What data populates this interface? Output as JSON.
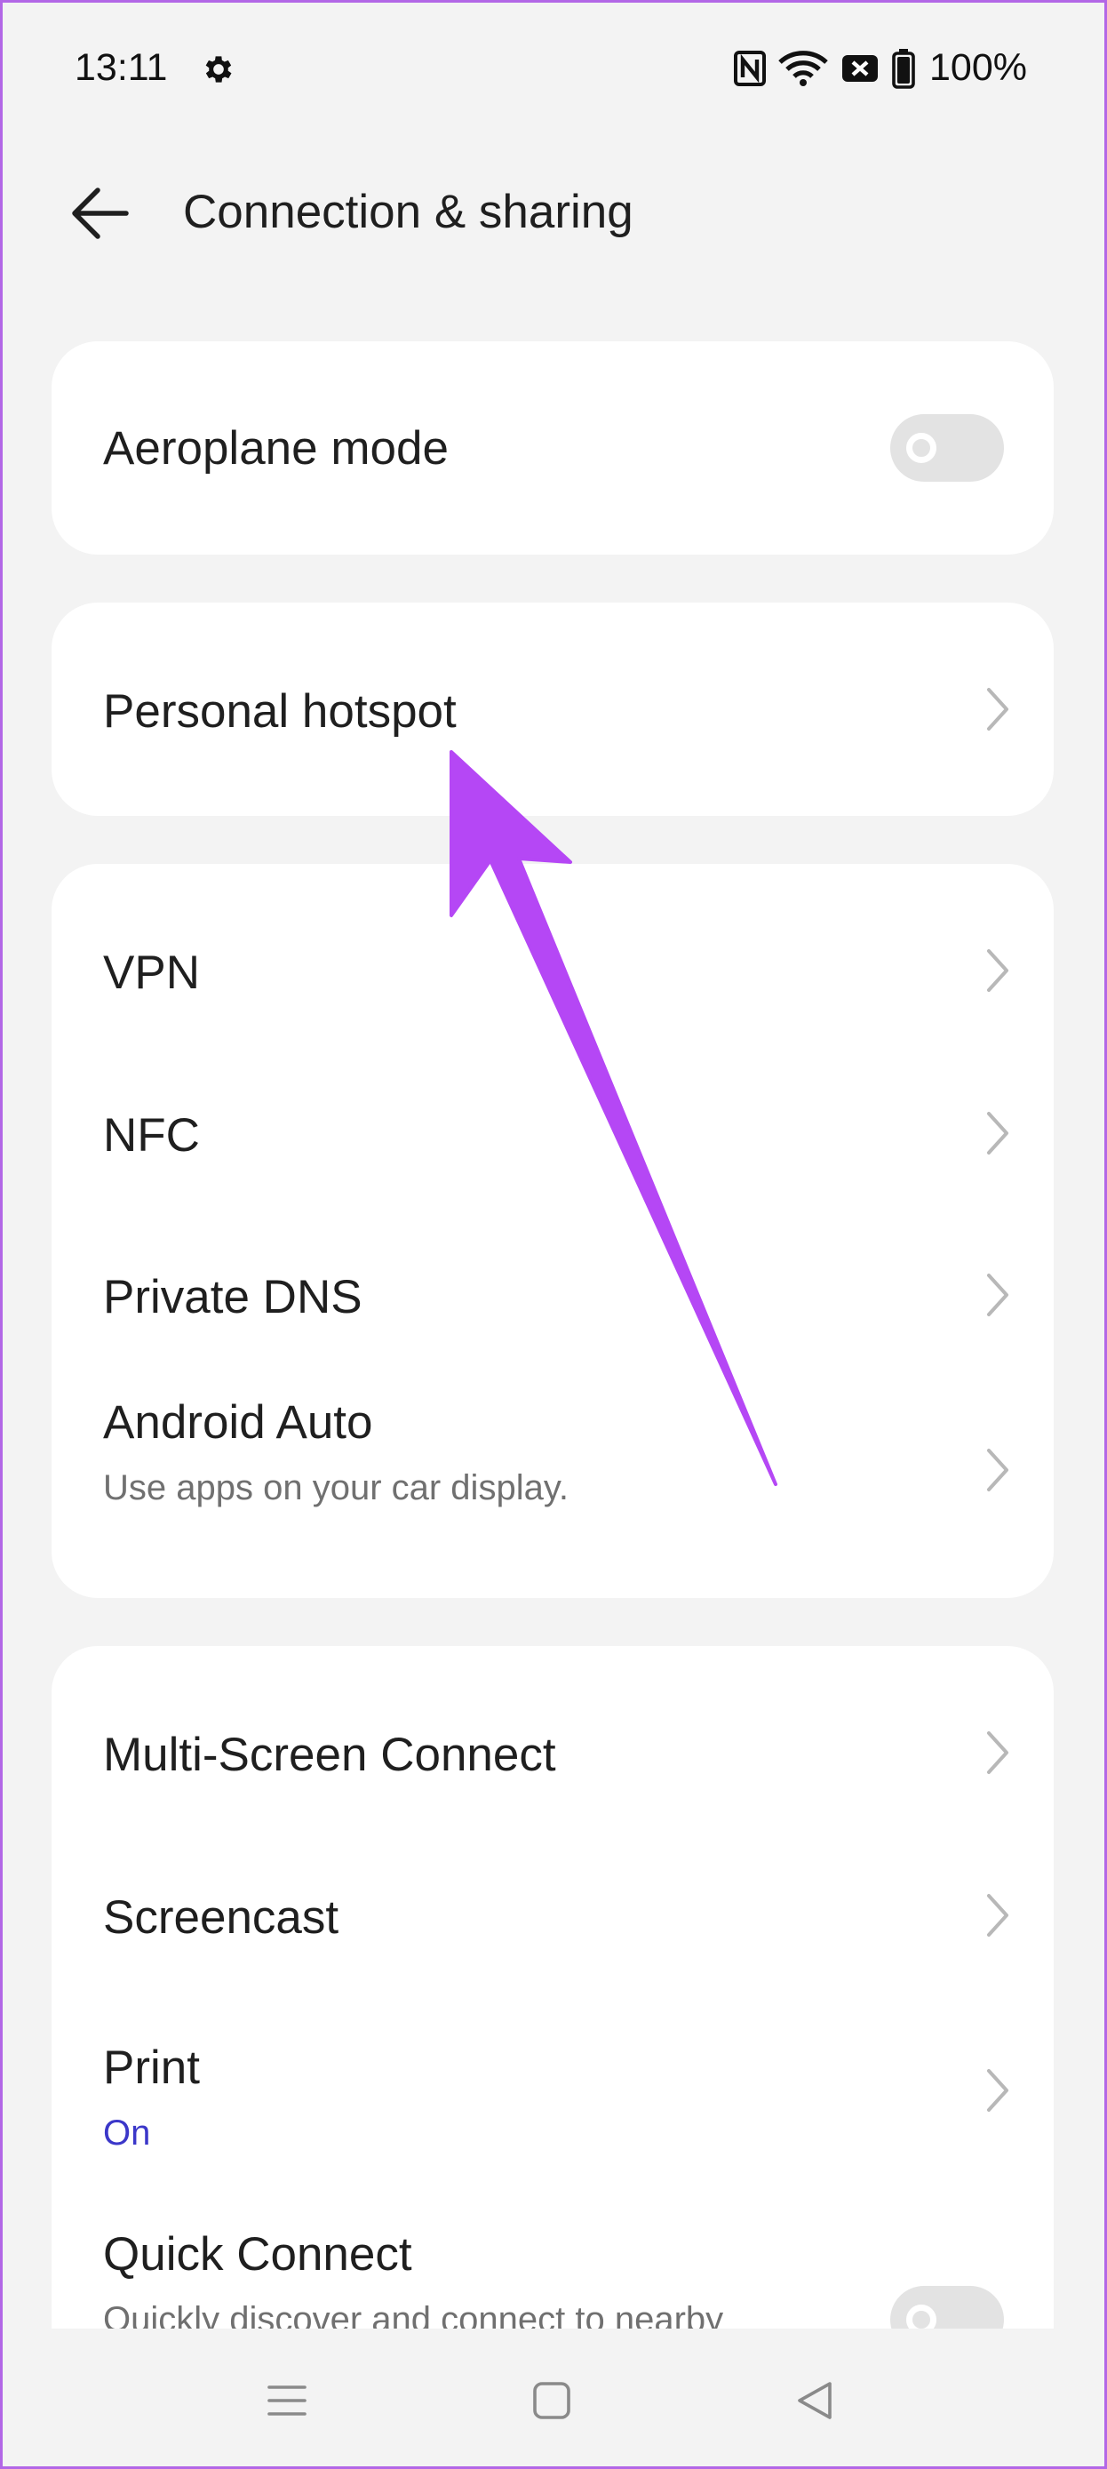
{
  "status_bar": {
    "time": "13:11",
    "battery": "100%",
    "icons": [
      "settings-gear-icon",
      "nfc-icon",
      "wifi-icon",
      "no-sim-icon",
      "battery-icon"
    ]
  },
  "header": {
    "title": "Connection & sharing",
    "back_icon": "back-arrow-icon"
  },
  "sections": {
    "airplane": {
      "label": "Aeroplane mode",
      "toggle_on": false
    },
    "hotspot": {
      "label": "Personal hotspot"
    },
    "network": {
      "items": [
        {
          "label": "VPN"
        },
        {
          "label": "NFC"
        },
        {
          "label": "Private DNS"
        },
        {
          "label": "Android Auto",
          "sub": "Use apps on your car display."
        }
      ]
    },
    "devices": {
      "items": [
        {
          "label": "Multi-Screen Connect"
        },
        {
          "label": "Screencast"
        },
        {
          "label": "Print",
          "sub": "On"
        },
        {
          "label": "Quick Connect",
          "sub": "Quickly discover and connect to nearby",
          "toggle_on": false
        }
      ]
    }
  },
  "nav_bar": {
    "icons": [
      "menu-icon",
      "home-icon",
      "back-icon"
    ]
  },
  "colors": {
    "background": "#f3f3f3",
    "card": "#ffffff",
    "accent_on": "#3b37c9",
    "annotation_arrow": "#b547f5"
  }
}
